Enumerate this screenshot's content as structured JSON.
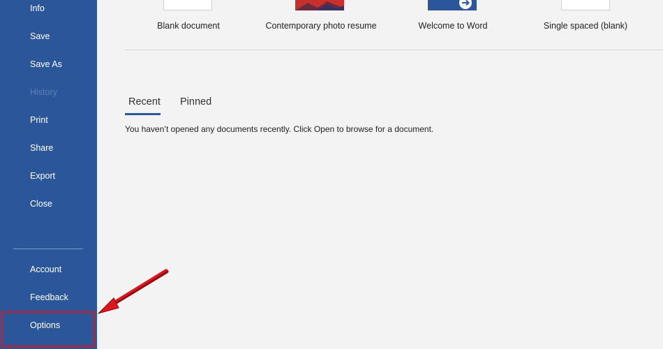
{
  "sidebar": {
    "items": [
      {
        "label": "Info",
        "enabled": true
      },
      {
        "label": "Save",
        "enabled": true
      },
      {
        "label": "Save As",
        "enabled": true
      },
      {
        "label": "History",
        "enabled": false
      },
      {
        "label": "Print",
        "enabled": true
      },
      {
        "label": "Share",
        "enabled": true
      },
      {
        "label": "Export",
        "enabled": true
      },
      {
        "label": "Close",
        "enabled": true
      }
    ],
    "bottom_items": [
      {
        "label": "Account"
      },
      {
        "label": "Feedback"
      },
      {
        "label": "Options"
      }
    ],
    "background": "#2b579a"
  },
  "templates": [
    {
      "label": "Blank document",
      "icon": "blank-page-thumbnail"
    },
    {
      "label": "Contemporary photo resume",
      "icon": "photo-resume-thumbnail"
    },
    {
      "label": "Welcome to Word",
      "icon": "welcome-arrow-thumbnail"
    },
    {
      "label": "Single spaced (blank)",
      "icon": "blank-page-thumbnail"
    }
  ],
  "tabs": [
    {
      "label": "Recent",
      "active": true
    },
    {
      "label": "Pinned",
      "active": false
    }
  ],
  "recent": {
    "empty_message": "You haven’t opened any documents recently. Click Open to browse for a document."
  },
  "annotation": {
    "highlight_color": "#e0141c",
    "pointer": "red-arrow-icon"
  }
}
